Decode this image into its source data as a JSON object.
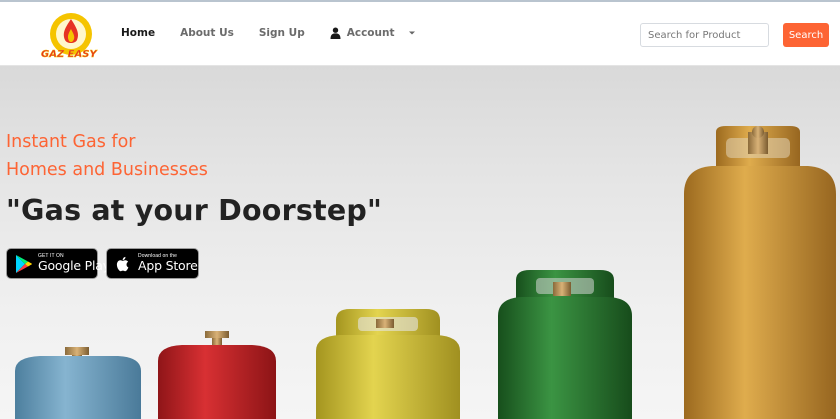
{
  "brand": {
    "logo_text": "GAZ EASY",
    "colors": {
      "accent": "#fd6434",
      "logo_yellow": "#f5c400",
      "logo_red": "#e63323"
    }
  },
  "nav": {
    "home": "Home",
    "about": "About Us",
    "signup": "Sign Up",
    "account": "Account",
    "account_icon": "person-icon",
    "dropdown_icon": "caret-down-icon"
  },
  "search": {
    "placeholder": "Search for Product",
    "button_label": "Search"
  },
  "hero": {
    "tagline_line1": "Instant Gas for",
    "tagline_line2": "Homes and Businesses",
    "headline": "\"Gas at your Doorstep\"",
    "google_play": {
      "small": "GET IT ON",
      "big": "Google Play"
    },
    "app_store": {
      "small": "Download on the",
      "big": "App Store"
    },
    "cylinder_colors": [
      "#6fa0c0",
      "#c8262a",
      "#d8c640",
      "#2d7f32",
      "#d4a03c"
    ]
  }
}
